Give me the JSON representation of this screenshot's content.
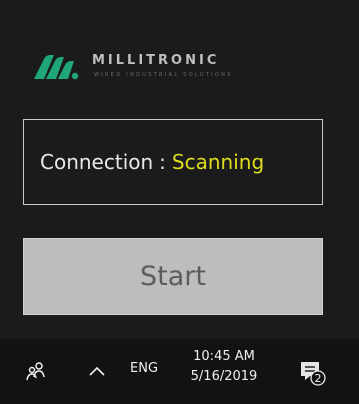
{
  "brand": {
    "name": "MILLITRONIC",
    "tagline": "WIRED INDUSTRIAL SOLUTIONS",
    "colors": {
      "logo_green": "#1fa67a",
      "logo_text": "#bfbfbf"
    }
  },
  "connection": {
    "label": "Connection",
    "separator": ":",
    "status": "Scanning",
    "status_color": "#dede1d"
  },
  "start_button": {
    "label": "Start"
  },
  "taskbar": {
    "icons": [
      "people-icon",
      "chevron-up-icon",
      "notification-icon"
    ],
    "language": "ENG",
    "time": "10:45 AM",
    "date": "5/16/2019",
    "notification_count": "2"
  }
}
